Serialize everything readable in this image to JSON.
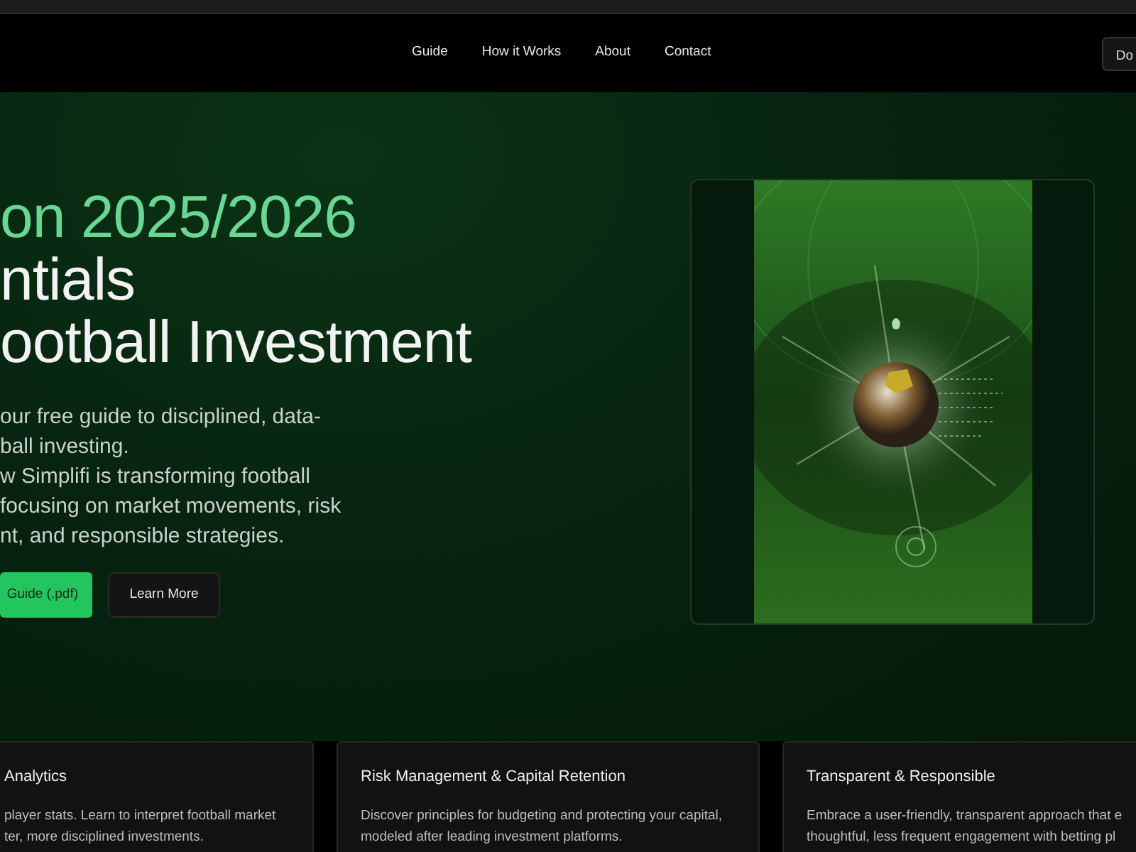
{
  "nav": {
    "links": [
      {
        "label": "Guide"
      },
      {
        "label": "How it Works"
      },
      {
        "label": "About"
      },
      {
        "label": "Contact"
      }
    ],
    "cta": "Do"
  },
  "hero": {
    "headline": [
      {
        "text": "on 2025/2026",
        "accent": true
      },
      {
        "text": "ntials",
        "accent": false
      },
      {
        "text": "ootball Investment",
        "accent": false
      }
    ],
    "description": [
      "our free guide to disciplined, data-",
      "ball investing.",
      "w Simplifi is transforming football",
      "focusing on market movements, risk",
      "nt, and responsible strategies."
    ],
    "buttons": [
      {
        "label": "Guide (.pdf)",
        "kind": "primary"
      },
      {
        "label": "Learn More",
        "kind": "secondary"
      }
    ]
  },
  "features": [
    {
      "title": "Analytics",
      "lines": [
        "player stats. Learn to interpret football market",
        "ter, more disciplined investments."
      ]
    },
    {
      "title": "Risk Management & Capital Retention",
      "lines": [
        "Discover principles for budgeting and protecting your capital,",
        "modeled after leading investment platforms."
      ]
    },
    {
      "title": "Transparent & Responsible",
      "lines": [
        "Embrace a user-friendly, transparent approach that e",
        "thoughtful, less frequent engagement with betting pl"
      ]
    }
  ]
}
